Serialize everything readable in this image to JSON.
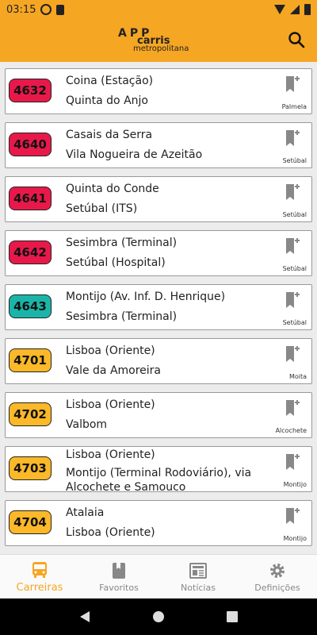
{
  "status": {
    "time": "03:15",
    "icons": [
      "play-circle-icon",
      "sim-card-icon",
      "wifi-icon",
      "signal-icon",
      "battery-icon"
    ]
  },
  "app_bar": {
    "logo_app": "APP",
    "logo_carris": "carris",
    "logo_metro": "metropolitana",
    "search_icon": "search-icon"
  },
  "colors": {
    "accent": "#f5a623",
    "red": "#e8194a",
    "teal": "#1ab5a8",
    "yellow": "#fbb829"
  },
  "routes": [
    {
      "number": "4632",
      "from": "Coina (Estação)",
      "to": "Quinta do Anjo",
      "municipality": "Palmela",
      "color": "#e8194a"
    },
    {
      "number": "4640",
      "from": "Casais da Serra",
      "to": "Vila Nogueira de Azeitão",
      "municipality": "Setúbal",
      "color": "#e8194a"
    },
    {
      "number": "4641",
      "from": "Quinta do Conde",
      "to": "Setúbal (ITS)",
      "municipality": "Setúbal",
      "color": "#e8194a"
    },
    {
      "number": "4642",
      "from": "Sesimbra (Terminal)",
      "to": "Setúbal (Hospital)",
      "municipality": "Setúbal",
      "color": "#e8194a"
    },
    {
      "number": "4643",
      "from": "Montijo (Av. Inf. D. Henrique)",
      "to": "Sesimbra (Terminal)",
      "municipality": "Setúbal",
      "color": "#1ab5a8"
    },
    {
      "number": "4701",
      "from": "Lisboa (Oriente)",
      "to": "Vale da Amoreira",
      "municipality": "Moita",
      "color": "#fbb829"
    },
    {
      "number": "4702",
      "from": "Lisboa (Oriente)",
      "to": "Valbom",
      "municipality": "Alcochete",
      "color": "#fbb829"
    },
    {
      "number": "4703",
      "from": "Lisboa (Oriente)",
      "to": "Montijo (Terminal Rodoviário), via Alcochete e Samouco",
      "municipality": "Montijo",
      "color": "#fbb829"
    },
    {
      "number": "4704",
      "from": "Atalaia",
      "to": "Lisboa (Oriente)",
      "municipality": "Montijo",
      "color": "#fbb829"
    }
  ],
  "nav": {
    "carreiras": "Carreiras",
    "favoritos": "Favoritos",
    "noticias": "Notícias",
    "definicoes": "Definições"
  }
}
